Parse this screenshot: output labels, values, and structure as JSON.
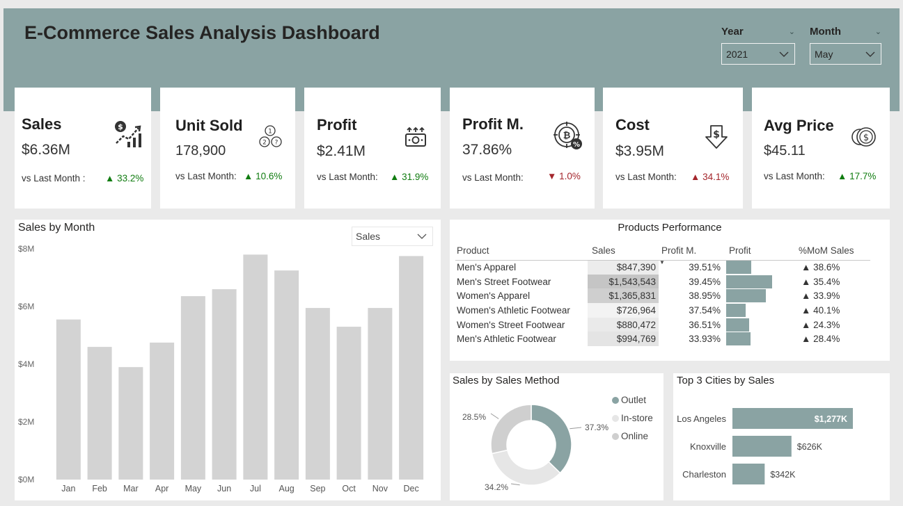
{
  "header": {
    "title": "E-Commerce Sales Analysis Dashboard"
  },
  "filters": {
    "year": {
      "label": "Year",
      "value": "2021"
    },
    "month": {
      "label": "Month",
      "value": "May"
    }
  },
  "kpis": [
    {
      "title": "Sales",
      "value": "$6.36M",
      "compare_label": "vs Last Month :",
      "delta": "33.2%",
      "direction": "up",
      "icon": "sales-growth-icon"
    },
    {
      "title": "Unit Sold",
      "value": "178,900",
      "compare_label": "vs Last Month:",
      "delta": "10.6%",
      "direction": "up",
      "icon": "units-icon"
    },
    {
      "title": "Profit",
      "value": "$2.41M",
      "compare_label": "vs Last Month:",
      "delta": "31.9%",
      "direction": "up",
      "icon": "money-icon"
    },
    {
      "title": "Profit M.",
      "value": "37.86%",
      "compare_label": "vs Last Month:",
      "delta": "1.0%",
      "direction": "down",
      "icon": "profit-margin-icon"
    },
    {
      "title": "Cost",
      "value": "$3.95M",
      "compare_label": "vs Last Month:",
      "delta": "34.1%",
      "direction": "up-negative",
      "icon": "cost-down-icon"
    },
    {
      "title": "Avg Price",
      "value": "$45.11",
      "compare_label": "vs Last Month:",
      "delta": "17.7%",
      "direction": "up",
      "icon": "coins-icon"
    }
  ],
  "colors": {
    "accent": "#8aa3a3",
    "bar_gray": "#d3d3d3",
    "up": "#107c10",
    "down": "#a4262c",
    "donut_light": "#e6e6e6",
    "donut_mid": "#cfcfcf"
  },
  "sales_by_month": {
    "title": "Sales by Month",
    "measure_selector": "Sales",
    "chart_data": {
      "type": "bar",
      "categories": [
        "Jan",
        "Feb",
        "Mar",
        "Apr",
        "May",
        "Jun",
        "Jul",
        "Aug",
        "Sep",
        "Oct",
        "Nov",
        "Dec"
      ],
      "values": [
        5.55,
        4.6,
        3.9,
        4.75,
        6.36,
        6.6,
        7.8,
        7.25,
        5.95,
        5.3,
        5.95,
        7.75
      ],
      "ylim": [
        0,
        8
      ],
      "yticks": [
        "$0M",
        "$2M",
        "$4M",
        "$6M",
        "$8M"
      ],
      "grid": false
    }
  },
  "products": {
    "title": "Products Performance",
    "columns": [
      "Product",
      "Sales",
      "Profit M.",
      "Profit",
      "%MoM Sales"
    ],
    "rows": [
      {
        "product": "Men's Apparel",
        "sales": "$847,390",
        "sales_value": 847390,
        "profit_margin": "39.51%",
        "profit_share": 0.36,
        "mom": "38.6%"
      },
      {
        "product": "Men's Street Footwear",
        "sales": "$1,543,543",
        "sales_value": 1543543,
        "profit_margin": "39.45%",
        "profit_share": 0.66,
        "mom": "35.4%"
      },
      {
        "product": "Women's Apparel",
        "sales": "$1,365,831",
        "sales_value": 1365831,
        "profit_margin": "38.95%",
        "profit_share": 0.57,
        "mom": "33.9%"
      },
      {
        "product": "Women's Athletic Footwear",
        "sales": "$726,964",
        "sales_value": 726964,
        "profit_margin": "37.54%",
        "profit_share": 0.28,
        "mom": "40.1%"
      },
      {
        "product": "Women's Street Footwear",
        "sales": "$880,472",
        "sales_value": 880472,
        "profit_margin": "36.51%",
        "profit_share": 0.33,
        "mom": "24.3%"
      },
      {
        "product": "Men's Athletic Footwear",
        "sales": "$994,769",
        "sales_value": 994769,
        "profit_margin": "33.93%",
        "profit_share": 0.35,
        "mom": "28.4%"
      }
    ]
  },
  "sales_method": {
    "title": "Sales by Sales Method",
    "chart_data": {
      "type": "pie",
      "labels": [
        "Outlet",
        "In-store",
        "Online"
      ],
      "values": [
        37.3,
        34.2,
        28.5
      ],
      "value_labels": [
        "37.3%",
        "34.2%",
        "28.5%"
      ],
      "colors": [
        "#8aa3a3",
        "#e6e6e6",
        "#cfcfcf"
      ],
      "legend": "right"
    }
  },
  "top_cities": {
    "title": "Top 3 Cities by Sales",
    "chart_data": {
      "type": "bar",
      "orientation": "horizontal",
      "categories": [
        "Los Angeles",
        "Knoxville",
        "Charleston"
      ],
      "values": [
        1277,
        626,
        342
      ],
      "value_labels": [
        "$1,277K",
        "$626K",
        "$342K"
      ]
    }
  }
}
